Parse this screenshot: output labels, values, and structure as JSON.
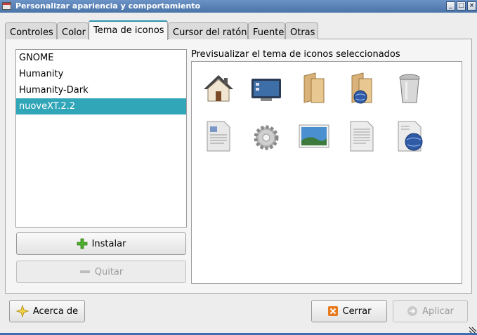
{
  "window": {
    "title": "Personalizar apariencia y comportamiento"
  },
  "tabs": [
    {
      "label": "Controles"
    },
    {
      "label": "Color"
    },
    {
      "label": "Tema de iconos",
      "active": true
    },
    {
      "label": "Cursor del ratón"
    },
    {
      "label": "Fuente"
    },
    {
      "label": "Otras"
    }
  ],
  "themes": {
    "items": [
      {
        "label": "GNOME"
      },
      {
        "label": "Humanity"
      },
      {
        "label": "Humanity-Dark"
      },
      {
        "label": "nuoveXT.2.2",
        "selected": true
      }
    ]
  },
  "buttons": {
    "install": "Instalar",
    "remove": "Quitar",
    "about": "Acerca de",
    "close": "Cerrar",
    "apply": "Aplicar"
  },
  "preview": {
    "label": "Previsualizar el tema de iconos seleccionados",
    "icons": [
      "home-icon",
      "computer-icon",
      "folder-icon",
      "network-folder-icon",
      "trash-icon",
      "text-document-icon",
      "settings-gear-icon",
      "image-icon",
      "document-icon",
      "web-document-icon"
    ]
  },
  "colors": {
    "accent": "#30a6b8",
    "titlebar": "#4a73a8"
  }
}
